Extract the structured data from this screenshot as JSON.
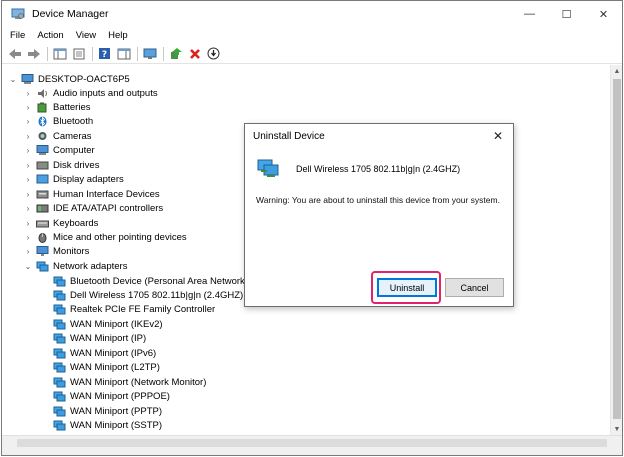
{
  "window": {
    "title": "Device Manager",
    "controls": {
      "minimize": "—",
      "maximize": "☐",
      "close": "✕"
    }
  },
  "menubar": [
    "File",
    "Action",
    "View",
    "Help"
  ],
  "toolbar": {
    "buttons": [
      "back-icon",
      "forward-icon",
      "show-hide-console-tree-icon",
      "properties-icon",
      "help-icon",
      "action-pane-icon",
      "monitor-icon",
      "update-driver-icon",
      "uninstall-icon",
      "disable-device-icon"
    ]
  },
  "tree": {
    "root": "DESKTOP-OACT6P5",
    "categories": [
      {
        "label": "Audio inputs and outputs",
        "expander": "›"
      },
      {
        "label": "Batteries",
        "expander": "›"
      },
      {
        "label": "Bluetooth",
        "expander": "›"
      },
      {
        "label": "Cameras",
        "expander": "›"
      },
      {
        "label": "Computer",
        "expander": "›"
      },
      {
        "label": "Disk drives",
        "expander": "›"
      },
      {
        "label": "Display adapters",
        "expander": "›"
      },
      {
        "label": "Human Interface Devices",
        "expander": "›"
      },
      {
        "label": "IDE ATA/ATAPI controllers",
        "expander": "›"
      },
      {
        "label": "Keyboards",
        "expander": "›"
      },
      {
        "label": "Mice and other pointing devices",
        "expander": "›"
      },
      {
        "label": "Monitors",
        "expander": "›"
      },
      {
        "label": "Network adapters",
        "expander": "⌄"
      }
    ],
    "network_children": [
      "Bluetooth Device (Personal Area Network)",
      "Dell Wireless 1705 802.11b|g|n (2.4GHZ)",
      "Realtek PCIe FE Family Controller",
      "WAN Miniport (IKEv2)",
      "WAN Miniport (IP)",
      "WAN Miniport (IPv6)",
      "WAN Miniport (L2TP)",
      "WAN Miniport (Network Monitor)",
      "WAN Miniport (PPPOE)",
      "WAN Miniport (PPTP)",
      "WAN Miniport (SSTP)"
    ]
  },
  "dialog": {
    "title": "Uninstall Device",
    "close": "✕",
    "device_name": "Dell Wireless 1705 802.11b|g|n (2.4GHZ)",
    "warning": "Warning: You are about to uninstall this device from your system.",
    "uninstall_label": "Uninstall",
    "cancel_label": "Cancel"
  },
  "colors": {
    "accent": "#0078d7",
    "highlight": "#e0246c",
    "window_border": "#7a7a7a"
  }
}
